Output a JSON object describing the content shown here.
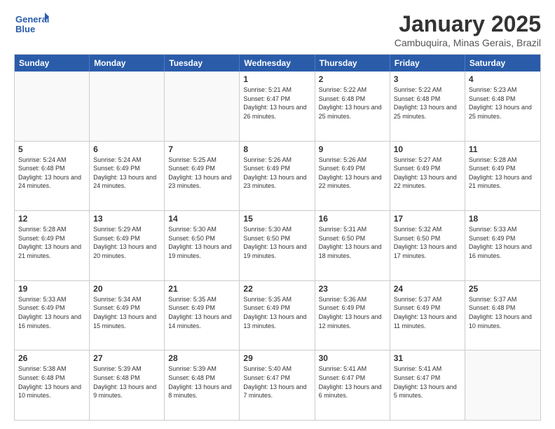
{
  "logo": {
    "line1": "General",
    "line2": "Blue"
  },
  "header": {
    "title": "January 2025",
    "subtitle": "Cambuquira, Minas Gerais, Brazil"
  },
  "weekdays": [
    "Sunday",
    "Monday",
    "Tuesday",
    "Wednesday",
    "Thursday",
    "Friday",
    "Saturday"
  ],
  "weeks": [
    [
      {
        "day": "",
        "info": ""
      },
      {
        "day": "",
        "info": ""
      },
      {
        "day": "",
        "info": ""
      },
      {
        "day": "1",
        "info": "Sunrise: 5:21 AM\nSunset: 6:47 PM\nDaylight: 13 hours and 26 minutes."
      },
      {
        "day": "2",
        "info": "Sunrise: 5:22 AM\nSunset: 6:48 PM\nDaylight: 13 hours and 25 minutes."
      },
      {
        "day": "3",
        "info": "Sunrise: 5:22 AM\nSunset: 6:48 PM\nDaylight: 13 hours and 25 minutes."
      },
      {
        "day": "4",
        "info": "Sunrise: 5:23 AM\nSunset: 6:48 PM\nDaylight: 13 hours and 25 minutes."
      }
    ],
    [
      {
        "day": "5",
        "info": "Sunrise: 5:24 AM\nSunset: 6:48 PM\nDaylight: 13 hours and 24 minutes."
      },
      {
        "day": "6",
        "info": "Sunrise: 5:24 AM\nSunset: 6:49 PM\nDaylight: 13 hours and 24 minutes."
      },
      {
        "day": "7",
        "info": "Sunrise: 5:25 AM\nSunset: 6:49 PM\nDaylight: 13 hours and 23 minutes."
      },
      {
        "day": "8",
        "info": "Sunrise: 5:26 AM\nSunset: 6:49 PM\nDaylight: 13 hours and 23 minutes."
      },
      {
        "day": "9",
        "info": "Sunrise: 5:26 AM\nSunset: 6:49 PM\nDaylight: 13 hours and 22 minutes."
      },
      {
        "day": "10",
        "info": "Sunrise: 5:27 AM\nSunset: 6:49 PM\nDaylight: 13 hours and 22 minutes."
      },
      {
        "day": "11",
        "info": "Sunrise: 5:28 AM\nSunset: 6:49 PM\nDaylight: 13 hours and 21 minutes."
      }
    ],
    [
      {
        "day": "12",
        "info": "Sunrise: 5:28 AM\nSunset: 6:49 PM\nDaylight: 13 hours and 21 minutes."
      },
      {
        "day": "13",
        "info": "Sunrise: 5:29 AM\nSunset: 6:49 PM\nDaylight: 13 hours and 20 minutes."
      },
      {
        "day": "14",
        "info": "Sunrise: 5:30 AM\nSunset: 6:50 PM\nDaylight: 13 hours and 19 minutes."
      },
      {
        "day": "15",
        "info": "Sunrise: 5:30 AM\nSunset: 6:50 PM\nDaylight: 13 hours and 19 minutes."
      },
      {
        "day": "16",
        "info": "Sunrise: 5:31 AM\nSunset: 6:50 PM\nDaylight: 13 hours and 18 minutes."
      },
      {
        "day": "17",
        "info": "Sunrise: 5:32 AM\nSunset: 6:50 PM\nDaylight: 13 hours and 17 minutes."
      },
      {
        "day": "18",
        "info": "Sunrise: 5:33 AM\nSunset: 6:49 PM\nDaylight: 13 hours and 16 minutes."
      }
    ],
    [
      {
        "day": "19",
        "info": "Sunrise: 5:33 AM\nSunset: 6:49 PM\nDaylight: 13 hours and 16 minutes."
      },
      {
        "day": "20",
        "info": "Sunrise: 5:34 AM\nSunset: 6:49 PM\nDaylight: 13 hours and 15 minutes."
      },
      {
        "day": "21",
        "info": "Sunrise: 5:35 AM\nSunset: 6:49 PM\nDaylight: 13 hours and 14 minutes."
      },
      {
        "day": "22",
        "info": "Sunrise: 5:35 AM\nSunset: 6:49 PM\nDaylight: 13 hours and 13 minutes."
      },
      {
        "day": "23",
        "info": "Sunrise: 5:36 AM\nSunset: 6:49 PM\nDaylight: 13 hours and 12 minutes."
      },
      {
        "day": "24",
        "info": "Sunrise: 5:37 AM\nSunset: 6:49 PM\nDaylight: 13 hours and 11 minutes."
      },
      {
        "day": "25",
        "info": "Sunrise: 5:37 AM\nSunset: 6:48 PM\nDaylight: 13 hours and 10 minutes."
      }
    ],
    [
      {
        "day": "26",
        "info": "Sunrise: 5:38 AM\nSunset: 6:48 PM\nDaylight: 13 hours and 10 minutes."
      },
      {
        "day": "27",
        "info": "Sunrise: 5:39 AM\nSunset: 6:48 PM\nDaylight: 13 hours and 9 minutes."
      },
      {
        "day": "28",
        "info": "Sunrise: 5:39 AM\nSunset: 6:48 PM\nDaylight: 13 hours and 8 minutes."
      },
      {
        "day": "29",
        "info": "Sunrise: 5:40 AM\nSunset: 6:47 PM\nDaylight: 13 hours and 7 minutes."
      },
      {
        "day": "30",
        "info": "Sunrise: 5:41 AM\nSunset: 6:47 PM\nDaylight: 13 hours and 6 minutes."
      },
      {
        "day": "31",
        "info": "Sunrise: 5:41 AM\nSunset: 6:47 PM\nDaylight: 13 hours and 5 minutes."
      },
      {
        "day": "",
        "info": ""
      }
    ]
  ]
}
